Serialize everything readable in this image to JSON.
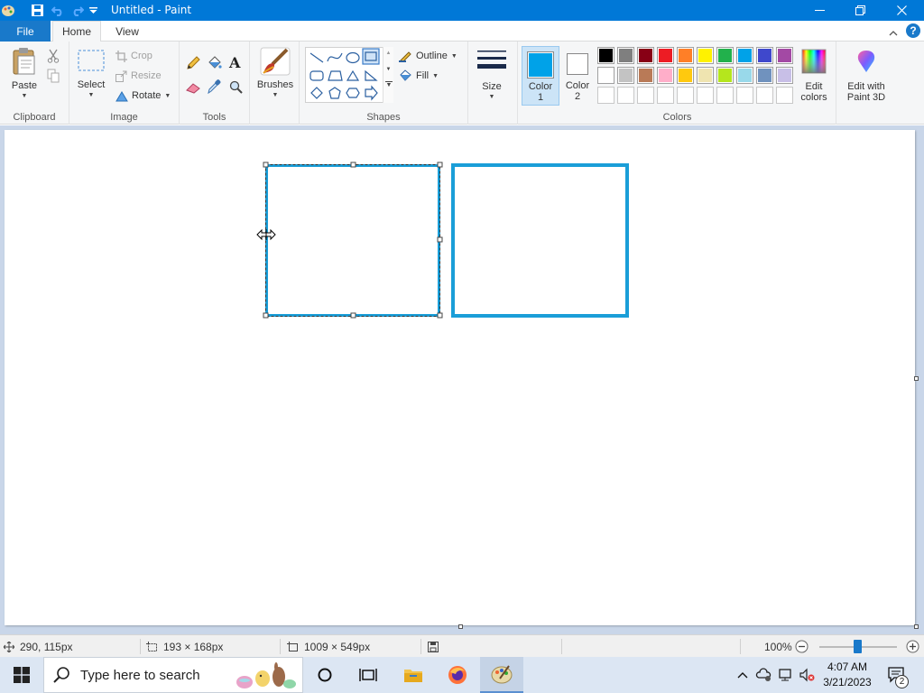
{
  "window": {
    "title": "Untitled - Paint"
  },
  "tabs": {
    "file": "File",
    "home": "Home",
    "view": "View"
  },
  "ribbon": {
    "clipboard": {
      "paste": "Paste",
      "label": "Clipboard"
    },
    "image": {
      "select": "Select",
      "crop": "Crop",
      "resize": "Resize",
      "rotate": "Rotate",
      "label": "Image"
    },
    "tools": {
      "label": "Tools"
    },
    "brushes": {
      "label": "Brushes"
    },
    "shapes": {
      "outline": "Outline",
      "fill": "Fill",
      "label": "Shapes"
    },
    "size": {
      "label": "Size"
    },
    "color1": {
      "label": "Color",
      "num": "1",
      "value": "#00a2e8"
    },
    "color2": {
      "label": "Color",
      "num": "2",
      "value": "#ffffff"
    },
    "colors": {
      "label": "Colors",
      "row1": [
        "#000000",
        "#7f7f7f",
        "#880015",
        "#ed1c24",
        "#ff7f27",
        "#fff200",
        "#22b14c",
        "#00a2e8",
        "#3f48cc",
        "#a349a4"
      ],
      "row2": [
        "#ffffff",
        "#c3c3c3",
        "#b97a57",
        "#ffaec9",
        "#ffc90e",
        "#efe4b0",
        "#b5e61d",
        "#99d9ea",
        "#7092be",
        "#c8bfe7"
      ],
      "row3": [
        "#ffffff",
        "#ffffff",
        "#ffffff",
        "#ffffff",
        "#ffffff",
        "#ffffff",
        "#ffffff",
        "#ffffff",
        "#ffffff",
        "#ffffff"
      ]
    },
    "edit_colors": {
      "line1": "Edit",
      "line2": "colors"
    },
    "paint3d": {
      "line1": "Edit with",
      "line2": "Paint 3D"
    }
  },
  "canvas": {
    "shape_color": "#1a9ed8"
  },
  "statusbar": {
    "cursor_pos": "290, 115px",
    "selection_size": "193 × 168px",
    "canvas_size": "1009 × 549px",
    "zoom": "100%",
    "zoom_level": 1.0
  },
  "taskbar": {
    "search_placeholder": "Type here to search",
    "time": "4:07 AM",
    "date": "3/21/2023",
    "notification_count": "2"
  }
}
